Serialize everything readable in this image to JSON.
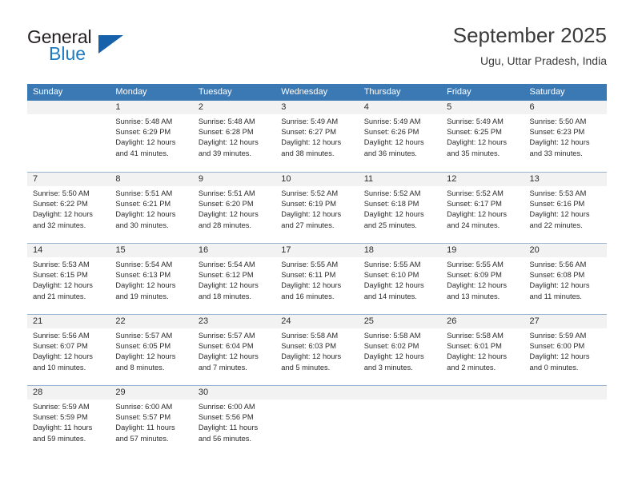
{
  "brand": {
    "name_part1": "General",
    "name_part2": "Blue",
    "accent_color": "#1e7bc1",
    "triangle_color": "#1661aa"
  },
  "header": {
    "title": "September 2025",
    "location": "Ugu, Uttar Pradesh, India"
  },
  "calendar": {
    "header_color": "#3b79b4",
    "weekdays": [
      "Sunday",
      "Monday",
      "Tuesday",
      "Wednesday",
      "Thursday",
      "Friday",
      "Saturday"
    ],
    "weeks": [
      [
        {
          "day": "",
          "empty": true
        },
        {
          "day": "1",
          "sunrise": "Sunrise: 5:48 AM",
          "sunset": "Sunset: 6:29 PM",
          "daylight_line1": "Daylight: 12 hours",
          "daylight_line2": "and 41 minutes."
        },
        {
          "day": "2",
          "sunrise": "Sunrise: 5:48 AM",
          "sunset": "Sunset: 6:28 PM",
          "daylight_line1": "Daylight: 12 hours",
          "daylight_line2": "and 39 minutes."
        },
        {
          "day": "3",
          "sunrise": "Sunrise: 5:49 AM",
          "sunset": "Sunset: 6:27 PM",
          "daylight_line1": "Daylight: 12 hours",
          "daylight_line2": "and 38 minutes."
        },
        {
          "day": "4",
          "sunrise": "Sunrise: 5:49 AM",
          "sunset": "Sunset: 6:26 PM",
          "daylight_line1": "Daylight: 12 hours",
          "daylight_line2": "and 36 minutes."
        },
        {
          "day": "5",
          "sunrise": "Sunrise: 5:49 AM",
          "sunset": "Sunset: 6:25 PM",
          "daylight_line1": "Daylight: 12 hours",
          "daylight_line2": "and 35 minutes."
        },
        {
          "day": "6",
          "sunrise": "Sunrise: 5:50 AM",
          "sunset": "Sunset: 6:23 PM",
          "daylight_line1": "Daylight: 12 hours",
          "daylight_line2": "and 33 minutes."
        }
      ],
      [
        {
          "day": "7",
          "sunrise": "Sunrise: 5:50 AM",
          "sunset": "Sunset: 6:22 PM",
          "daylight_line1": "Daylight: 12 hours",
          "daylight_line2": "and 32 minutes."
        },
        {
          "day": "8",
          "sunrise": "Sunrise: 5:51 AM",
          "sunset": "Sunset: 6:21 PM",
          "daylight_line1": "Daylight: 12 hours",
          "daylight_line2": "and 30 minutes."
        },
        {
          "day": "9",
          "sunrise": "Sunrise: 5:51 AM",
          "sunset": "Sunset: 6:20 PM",
          "daylight_line1": "Daylight: 12 hours",
          "daylight_line2": "and 28 minutes."
        },
        {
          "day": "10",
          "sunrise": "Sunrise: 5:52 AM",
          "sunset": "Sunset: 6:19 PM",
          "daylight_line1": "Daylight: 12 hours",
          "daylight_line2": "and 27 minutes."
        },
        {
          "day": "11",
          "sunrise": "Sunrise: 5:52 AM",
          "sunset": "Sunset: 6:18 PM",
          "daylight_line1": "Daylight: 12 hours",
          "daylight_line2": "and 25 minutes."
        },
        {
          "day": "12",
          "sunrise": "Sunrise: 5:52 AM",
          "sunset": "Sunset: 6:17 PM",
          "daylight_line1": "Daylight: 12 hours",
          "daylight_line2": "and 24 minutes."
        },
        {
          "day": "13",
          "sunrise": "Sunrise: 5:53 AM",
          "sunset": "Sunset: 6:16 PM",
          "daylight_line1": "Daylight: 12 hours",
          "daylight_line2": "and 22 minutes."
        }
      ],
      [
        {
          "day": "14",
          "sunrise": "Sunrise: 5:53 AM",
          "sunset": "Sunset: 6:15 PM",
          "daylight_line1": "Daylight: 12 hours",
          "daylight_line2": "and 21 minutes."
        },
        {
          "day": "15",
          "sunrise": "Sunrise: 5:54 AM",
          "sunset": "Sunset: 6:13 PM",
          "daylight_line1": "Daylight: 12 hours",
          "daylight_line2": "and 19 minutes."
        },
        {
          "day": "16",
          "sunrise": "Sunrise: 5:54 AM",
          "sunset": "Sunset: 6:12 PM",
          "daylight_line1": "Daylight: 12 hours",
          "daylight_line2": "and 18 minutes."
        },
        {
          "day": "17",
          "sunrise": "Sunrise: 5:55 AM",
          "sunset": "Sunset: 6:11 PM",
          "daylight_line1": "Daylight: 12 hours",
          "daylight_line2": "and 16 minutes."
        },
        {
          "day": "18",
          "sunrise": "Sunrise: 5:55 AM",
          "sunset": "Sunset: 6:10 PM",
          "daylight_line1": "Daylight: 12 hours",
          "daylight_line2": "and 14 minutes."
        },
        {
          "day": "19",
          "sunrise": "Sunrise: 5:55 AM",
          "sunset": "Sunset: 6:09 PM",
          "daylight_line1": "Daylight: 12 hours",
          "daylight_line2": "and 13 minutes."
        },
        {
          "day": "20",
          "sunrise": "Sunrise: 5:56 AM",
          "sunset": "Sunset: 6:08 PM",
          "daylight_line1": "Daylight: 12 hours",
          "daylight_line2": "and 11 minutes."
        }
      ],
      [
        {
          "day": "21",
          "sunrise": "Sunrise: 5:56 AM",
          "sunset": "Sunset: 6:07 PM",
          "daylight_line1": "Daylight: 12 hours",
          "daylight_line2": "and 10 minutes."
        },
        {
          "day": "22",
          "sunrise": "Sunrise: 5:57 AM",
          "sunset": "Sunset: 6:05 PM",
          "daylight_line1": "Daylight: 12 hours",
          "daylight_line2": "and 8 minutes."
        },
        {
          "day": "23",
          "sunrise": "Sunrise: 5:57 AM",
          "sunset": "Sunset: 6:04 PM",
          "daylight_line1": "Daylight: 12 hours",
          "daylight_line2": "and 7 minutes."
        },
        {
          "day": "24",
          "sunrise": "Sunrise: 5:58 AM",
          "sunset": "Sunset: 6:03 PM",
          "daylight_line1": "Daylight: 12 hours",
          "daylight_line2": "and 5 minutes."
        },
        {
          "day": "25",
          "sunrise": "Sunrise: 5:58 AM",
          "sunset": "Sunset: 6:02 PM",
          "daylight_line1": "Daylight: 12 hours",
          "daylight_line2": "and 3 minutes."
        },
        {
          "day": "26",
          "sunrise": "Sunrise: 5:58 AM",
          "sunset": "Sunset: 6:01 PM",
          "daylight_line1": "Daylight: 12 hours",
          "daylight_line2": "and 2 minutes."
        },
        {
          "day": "27",
          "sunrise": "Sunrise: 5:59 AM",
          "sunset": "Sunset: 6:00 PM",
          "daylight_line1": "Daylight: 12 hours",
          "daylight_line2": "and 0 minutes."
        }
      ],
      [
        {
          "day": "28",
          "sunrise": "Sunrise: 5:59 AM",
          "sunset": "Sunset: 5:59 PM",
          "daylight_line1": "Daylight: 11 hours",
          "daylight_line2": "and 59 minutes."
        },
        {
          "day": "29",
          "sunrise": "Sunrise: 6:00 AM",
          "sunset": "Sunset: 5:57 PM",
          "daylight_line1": "Daylight: 11 hours",
          "daylight_line2": "and 57 minutes."
        },
        {
          "day": "30",
          "sunrise": "Sunrise: 6:00 AM",
          "sunset": "Sunset: 5:56 PM",
          "daylight_line1": "Daylight: 11 hours",
          "daylight_line2": "and 56 minutes."
        },
        {
          "day": "",
          "empty": true
        },
        {
          "day": "",
          "empty": true
        },
        {
          "day": "",
          "empty": true
        },
        {
          "day": "",
          "empty": true
        }
      ]
    ]
  }
}
